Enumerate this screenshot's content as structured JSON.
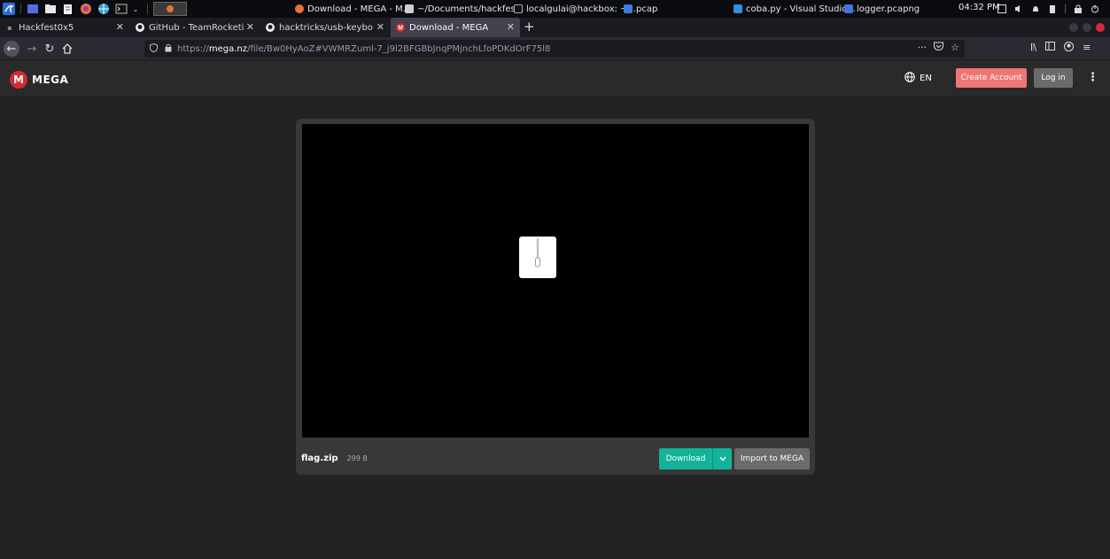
{
  "taskbar": {
    "windows": [
      {
        "label": "Download - MEGA - M...",
        "color": "#e8703a"
      },
      {
        "label": "~/Documents/hackfes...",
        "color": "#cfcfcf"
      },
      {
        "label": "localgulai@hackbox: ~...",
        "color": "#9a9a9a"
      },
      {
        "label": "pcap",
        "color": "#3f7de0"
      },
      {
        "label": "coba.py - Visual Studio...",
        "color": "#2f8fe0"
      },
      {
        "label": "logger.pcapng",
        "color": "#3a79d8"
      }
    ],
    "clock": "04:32 PM"
  },
  "tabs": [
    {
      "label": "Hackfest0x5",
      "active": false,
      "icon": "ctf-icon"
    },
    {
      "label": "GitHub - TeamRocketist/",
      "active": false,
      "icon": "github-icon"
    },
    {
      "label": "hacktricks/usb-keyboard",
      "active": false,
      "icon": "github-icon"
    },
    {
      "label": "Download - MEGA",
      "active": true,
      "icon": "mega-favicon"
    }
  ],
  "url": {
    "scheme": "https://",
    "host": "mega.nz",
    "path": "/file/Bw0HyAoZ#VWMRZuml-7_j9l2BFGBbJnqPMjnchLfoPDKdOrF75l8"
  },
  "mega": {
    "brand": "MEGA",
    "language": "EN",
    "create_account": "Create Account",
    "login": "Log in",
    "accent": "#d9272e"
  },
  "file": {
    "name": "flag.zip",
    "size": "299 B"
  },
  "actions": {
    "download": "Download",
    "import": "Import to MEGA"
  }
}
